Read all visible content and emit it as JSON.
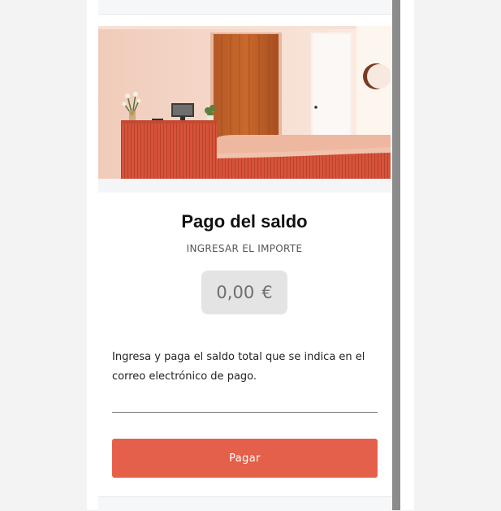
{
  "page": {
    "title": "Pago del saldo",
    "subtitle": "INGRESAR EL IMPORTE",
    "amount": {
      "value": "0,00",
      "currency": "€"
    },
    "description": "Ingresa y paga el saldo total que se indica en el correo electrónico de pago.",
    "pay_button_label": "Pagar"
  },
  "colors": {
    "accent": "#e5604a",
    "amount_box": "#e4e4e4",
    "background": "#f3f3f3"
  },
  "icons": {
    "hero": "reception-desk-photo"
  }
}
